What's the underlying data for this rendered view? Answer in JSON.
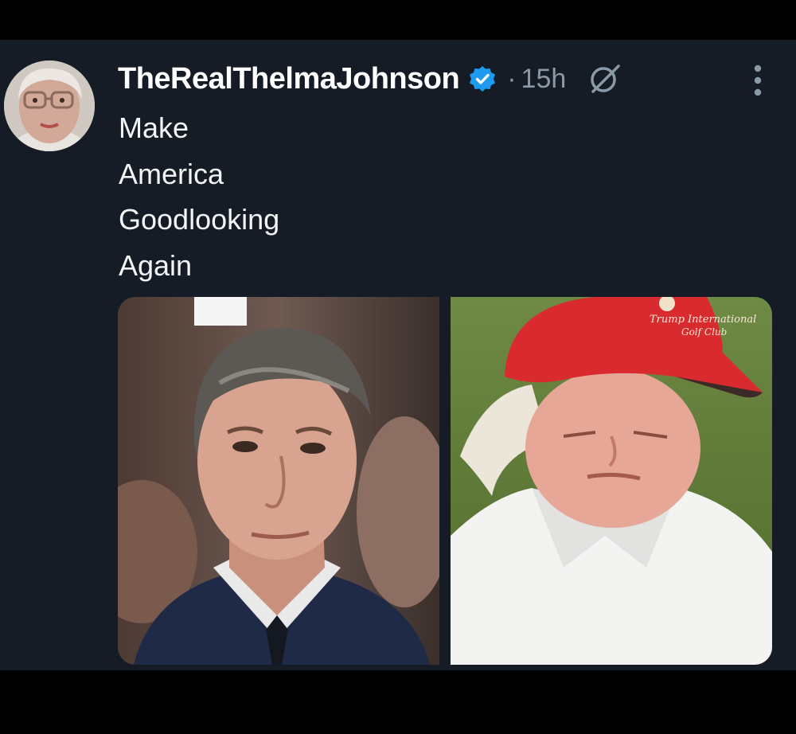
{
  "tweet": {
    "display_name": "TheRealThelmaJohnson",
    "separator": "·",
    "timestamp": "15h",
    "lines": [
      "Make",
      "America",
      "Goodlooking",
      "Again"
    ],
    "verified": true
  },
  "icons": {
    "verified": "verified-badge-icon",
    "grok": "grok-icon",
    "more": "more-vertical-icon"
  },
  "media": {
    "left_photo": "portrait of a man in a suit",
    "right_photo": {
      "cap_text_line1": "Trump International",
      "cap_text_line2": "Golf Club"
    }
  },
  "colors": {
    "background": "#161c26",
    "verified_blue": "#1d9bf0",
    "muted": "#8b98a5",
    "cap_red": "#d92b2f"
  }
}
